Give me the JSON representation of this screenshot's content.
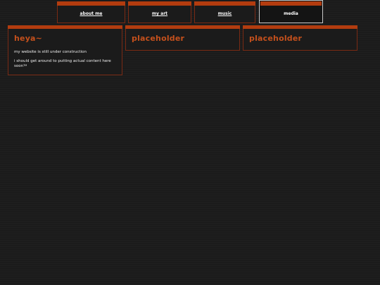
{
  "nav": {
    "tabs": [
      {
        "label": "about me",
        "active": false
      },
      {
        "label": "my art",
        "active": false
      },
      {
        "label": "music",
        "active": false
      },
      {
        "label": "media",
        "active": true
      }
    ]
  },
  "cards": [
    {
      "title": "heya~",
      "paragraph_1": "my website is still under construction",
      "paragraph_2": "i should get around to putting actual content here soon",
      "paragraph_2_sup": "TM"
    },
    {
      "title": "placeholder"
    },
    {
      "title": "placeholder"
    }
  ],
  "colors": {
    "accent": "#b33c0f",
    "title": "#c4501c",
    "border": "#7a2a14",
    "background": "#1b1b1b"
  }
}
